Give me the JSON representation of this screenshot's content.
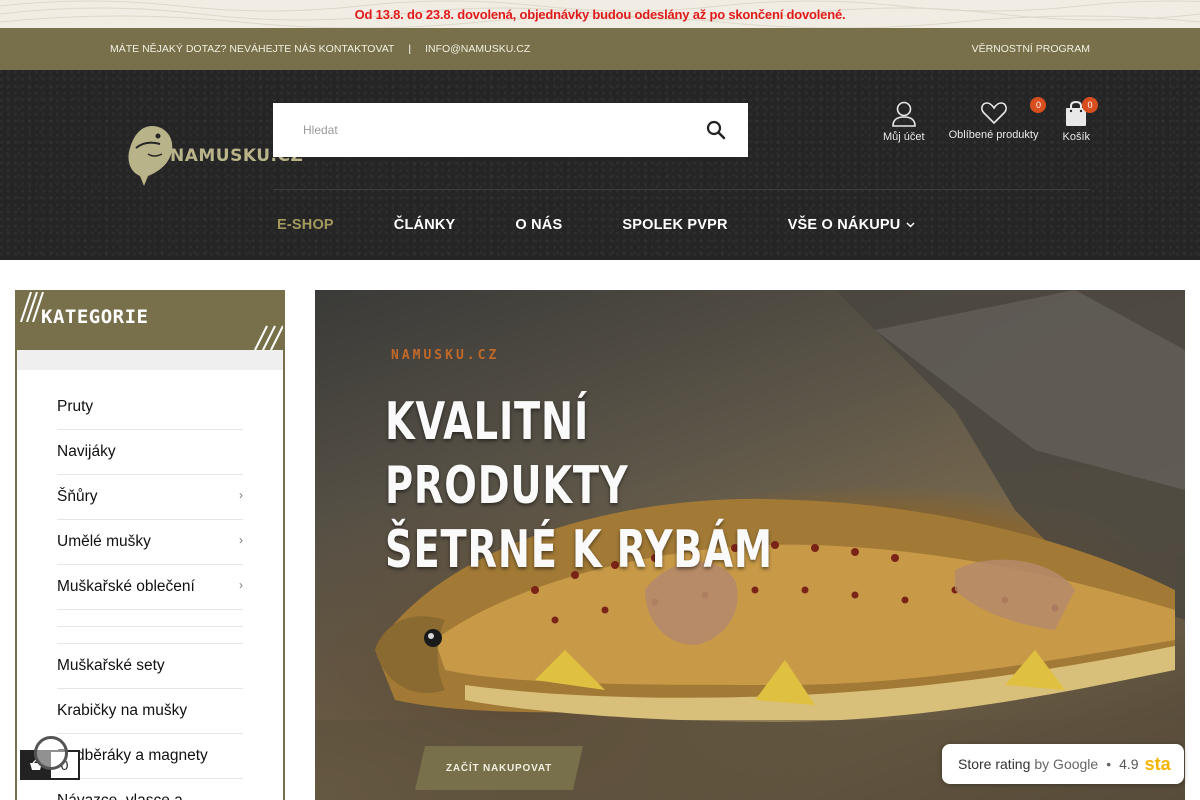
{
  "notice": {
    "text": "Od 13.8. do 23.8. dovolená, objednávky budou odeslány až po skončení dovolené."
  },
  "contact_bar": {
    "question": "MÁTE NĚJAKÝ DOTAZ? NEVÁHEJTE NÁS KONTAKTOVAT",
    "separator": "|",
    "email": "INFO@NAMUSKU.CZ",
    "loyalty": "VĚRNOSTNÍ PROGRAM"
  },
  "header": {
    "logo_text": "NAMUSKU.CZ",
    "search": {
      "placeholder": "Hledat",
      "value": ""
    },
    "account_label": "Můj účet",
    "favorites_label": "Oblíbené produkty",
    "favorites_count": "0",
    "cart_label": "Košík",
    "cart_count": "0"
  },
  "nav": {
    "items": [
      {
        "label": "E-SHOP"
      },
      {
        "label": "ČLÁNKY"
      },
      {
        "label": "O NÁS"
      },
      {
        "label": "SPOLEK PVPR"
      },
      {
        "label": "VŠE O NÁKUPU"
      }
    ]
  },
  "sidebar": {
    "title": "KATEGORIE",
    "items": [
      {
        "label": "Pruty"
      },
      {
        "label": "Navijáky"
      },
      {
        "label": "Šňůry"
      },
      {
        "label": "Umělé mušky"
      },
      {
        "label": "Muškařské oblečení"
      },
      {
        "label": "Muškařské sety"
      },
      {
        "label": "Krabičky na mušky"
      },
      {
        "label": "Podběráky a magnety"
      },
      {
        "label": "Návazce, vlasce a"
      }
    ]
  },
  "hero": {
    "brand": "NAMUSKU.CZ",
    "title_line1": "KVALITNÍ PRODUKTY",
    "title_line2": "ŠETRNÉ K RYBÁM",
    "cta": "ZAČÍT NAKUPOVAT"
  },
  "rating": {
    "label": "Store rating",
    "by": "by Google",
    "dot": "•",
    "score": "4.9",
    "stars_text": "sta"
  },
  "mini_cart": {
    "count": "0"
  },
  "colors": {
    "olive": "#77704a",
    "header_bg": "#252525",
    "notice_red": "#e01a1a",
    "badge": "#d94e1f",
    "nav_active": "#a39a5e"
  }
}
